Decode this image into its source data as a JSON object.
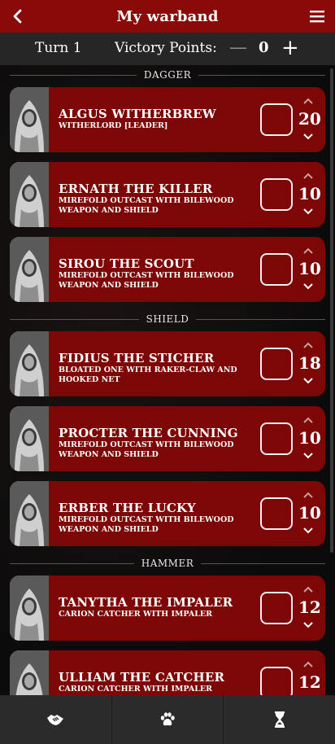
{
  "header": {
    "title": "My warband",
    "back_icon": "chevron-left-icon",
    "menu_icon": "hamburger-menu-icon"
  },
  "turnbar": {
    "turn_label": "Turn 1",
    "vp_label": "Victory Points:",
    "minus": "—",
    "vp_value": "0",
    "plus": "+"
  },
  "groups": [
    {
      "name": "DAGGER",
      "fighters": [
        {
          "name": "ALGUS WITHERBREW",
          "desc": "WITHERLORD [LEADER]",
          "value": "20"
        },
        {
          "name": "ERNATH THE KILLER",
          "desc": "MIREFOLD OUTCAST WITH BILEWOOD WEAPON AND SHIELD",
          "value": "10"
        },
        {
          "name": "SIROU THE SCOUT",
          "desc": "MIREFOLD OUTCAST WITH BILEWOOD WEAPON AND SHIELD",
          "value": "10"
        }
      ]
    },
    {
      "name": "SHIELD",
      "fighters": [
        {
          "name": "FIDIUS THE STICHER",
          "desc": "BLOATED ONE WITH RAKER-CLAW AND HOOKED NET",
          "value": "18"
        },
        {
          "name": "PROCTER THE CUNNING",
          "desc": "MIREFOLD OUTCAST WITH BILEWOOD WEAPON AND SHIELD",
          "value": "10"
        },
        {
          "name": "ERBER THE LUCKY",
          "desc": "MIREFOLD OUTCAST WITH BILEWOOD WEAPON AND SHIELD",
          "value": "10"
        }
      ]
    },
    {
      "name": "HAMMER",
      "fighters": [
        {
          "name": "TANYTHA THE IMPALER",
          "desc": "CARION CATCHER WITH IMPALER",
          "value": "12"
        },
        {
          "name": "ULLIAM THE CATCHER",
          "desc": "CARION CATCHER WITH IMPALER",
          "value": "12"
        }
      ]
    }
  ],
  "bottom_nav": {
    "items": [
      "handshake-icon",
      "paw-icon",
      "hourglass-icon"
    ]
  },
  "colors": {
    "accent": "#8a0a0a",
    "card": "#7d0606",
    "bar": "#262626"
  }
}
